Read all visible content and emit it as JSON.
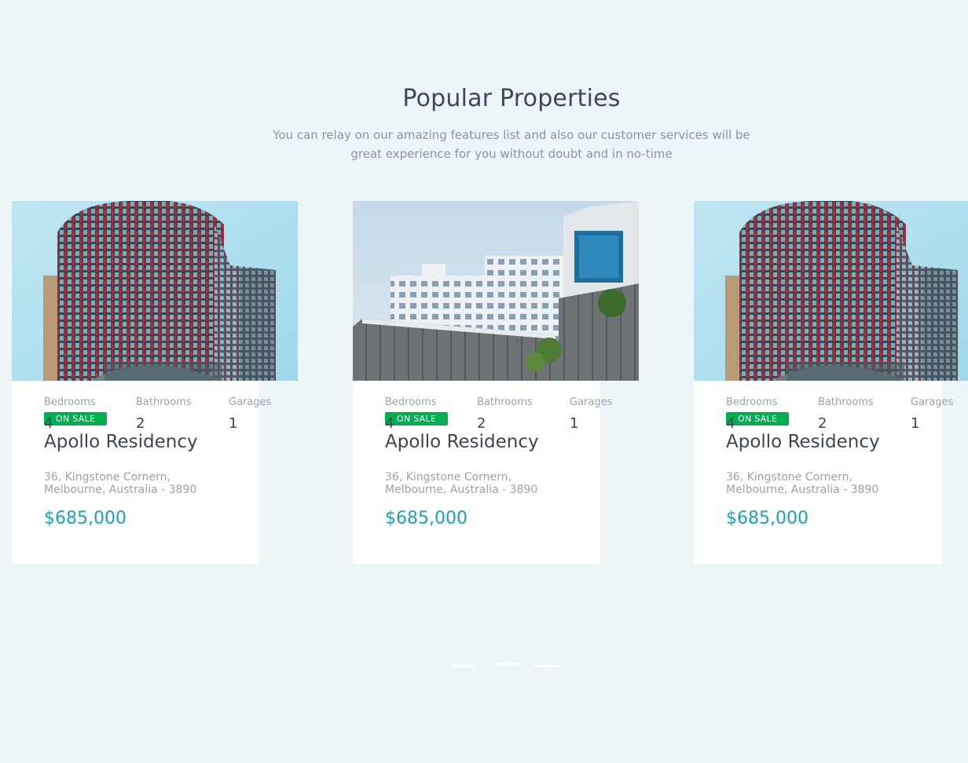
{
  "section": {
    "title": "Popular Properties",
    "subtitle": "You can relay on our amazing features list and also our customer services will be great experience for you without doubt and in no-time"
  },
  "colors": {
    "background": "#eef5f8",
    "badge": "#00b050",
    "price": "#1aa3b5",
    "card": "#ffffff"
  },
  "properties": [
    {
      "image": "red-glass-tower-photo",
      "badge": "ON SALE",
      "title": "Apollo Residency",
      "address": "36, Kingstone Cornern, Melbourne, Australia - 3890",
      "price": "$685,000",
      "features": [
        {
          "label": "Bedrooms",
          "value": "4"
        },
        {
          "label": "Bathrooms",
          "value": "2"
        },
        {
          "label": "Garages",
          "value": "1"
        }
      ]
    },
    {
      "image": "white-apartments-photo",
      "badge": "ON SALE",
      "title": "Apollo Residency",
      "address": "36, Kingstone Cornern, Melbourne, Australia - 3890",
      "price": "$685,000",
      "features": [
        {
          "label": "Bedrooms",
          "value": "4"
        },
        {
          "label": "Bathrooms",
          "value": "2"
        },
        {
          "label": "Garages",
          "value": "1"
        }
      ]
    },
    {
      "image": "red-glass-tower-photo",
      "badge": "ON SALE",
      "title": "Apollo Residency",
      "address": "36, Kingstone Cornern, Melbourne, Australia - 3890",
      "price": "$685,000",
      "features": [
        {
          "label": "Bedrooms",
          "value": "4"
        },
        {
          "label": "Bathrooms",
          "value": "2"
        },
        {
          "label": "Garages",
          "value": "1"
        }
      ]
    }
  ],
  "carousel": {
    "slides": 3,
    "active": 3
  }
}
